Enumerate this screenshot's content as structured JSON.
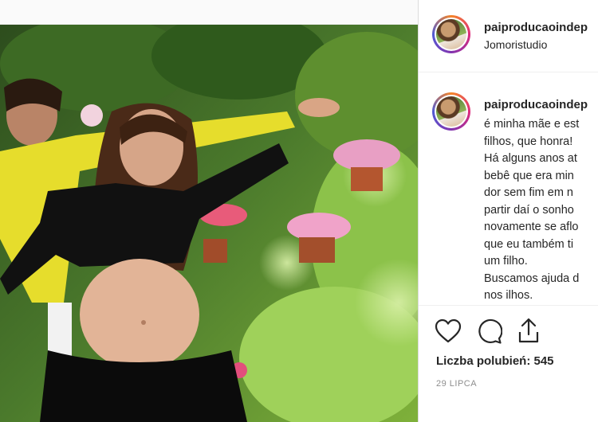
{
  "post": {
    "username": "paiproducaoindep",
    "location": "Jomoristudio"
  },
  "comment": {
    "username": "paiproducaoindep",
    "caption": "é minha mãe e est\nfilhos, que honra!\nHá alguns anos at\nbebê que era min\ndor sem fim em n\npartir daí o sonho\nnovamente se aflo\nque eu também ti\num filho.\nBuscamos ajuda d\nnos ilhos."
  },
  "actions": {
    "like_icon": "heart-icon",
    "comment_icon": "comment-icon",
    "share_icon": "share-icon"
  },
  "likes_text": "Liczba polubień: 545",
  "date_text": "29 LIPCA",
  "colors": {
    "accent_ring": "#dd2a7b",
    "text": "#262626",
    "muted": "#8e8e8e"
  }
}
